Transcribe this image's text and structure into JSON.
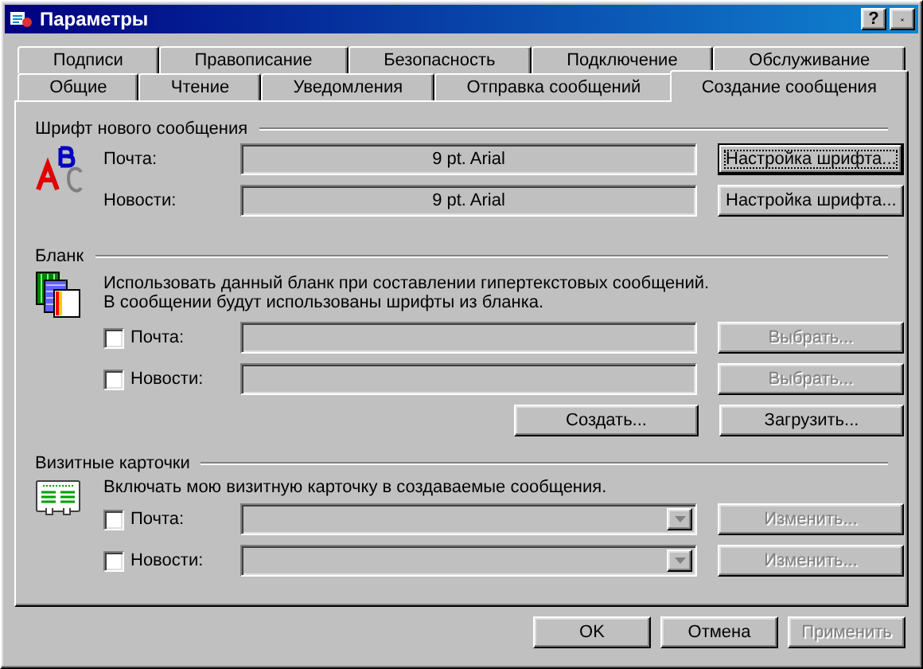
{
  "window": {
    "title": "Параметры",
    "help": "?"
  },
  "tab_rows": [
    [
      {
        "label": "Подписи",
        "selected": false
      },
      {
        "label": "Правописание",
        "selected": false
      },
      {
        "label": "Безопасность",
        "selected": false
      },
      {
        "label": "Подключение",
        "selected": false
      },
      {
        "label": "Обслуживание",
        "selected": false
      }
    ],
    [
      {
        "label": "Общие",
        "selected": false
      },
      {
        "label": "Чтение",
        "selected": false
      },
      {
        "label": "Уведомления",
        "selected": false
      },
      {
        "label": "Отправка сообщений",
        "selected": false
      },
      {
        "label": "Создание сообщения",
        "selected": true
      }
    ]
  ],
  "font_section": {
    "title": "Шрифт нового сообщения",
    "rows": [
      {
        "label": "Почта:",
        "value": "9 pt. Arial",
        "button": "Настройка шрифта...",
        "focused": true
      },
      {
        "label": "Новости:",
        "value": "9 pt. Arial",
        "button": "Настройка шрифта...",
        "focused": false
      }
    ]
  },
  "stationery_section": {
    "title": "Бланк",
    "description": [
      "Использовать данный бланк при составлении гипертекстовых сообщений.",
      "В сообщении будут использованы шрифты из бланка."
    ],
    "rows": [
      {
        "label": "Почта:",
        "checked": false,
        "button": "Выбрать...",
        "disabled": true
      },
      {
        "label": "Новости:",
        "checked": false,
        "button": "Выбрать...",
        "disabled": true
      }
    ],
    "buttons": [
      {
        "label": "Создать...",
        "disabled": false
      },
      {
        "label": "Загрузить...",
        "disabled": false
      }
    ]
  },
  "business_card_section": {
    "title": "Визитные карточки",
    "description": "Включать мою визитную карточку в создаваемые сообщения.",
    "rows": [
      {
        "label": "Почта:",
        "checked": false,
        "button": "Изменить...",
        "disabled": true
      },
      {
        "label": "Новости:",
        "checked": false,
        "button": "Изменить...",
        "disabled": true
      }
    ]
  },
  "buttons": [
    {
      "label": "OK",
      "disabled": false
    },
    {
      "label": "Отмена",
      "disabled": false
    },
    {
      "label": "Применить",
      "disabled": true
    }
  ]
}
